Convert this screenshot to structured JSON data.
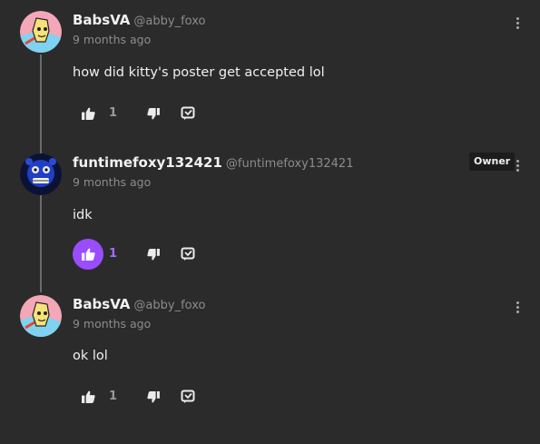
{
  "comments": [
    {
      "username": "BabsVA",
      "handle": "@abby_foxo",
      "timestamp": "9 months ago",
      "text": "how did kitty's poster get accepted lol",
      "like_count": "1",
      "liked": false,
      "avatar": "yellow-cartoon-avatar"
    },
    {
      "username": "funtimefoxy132421",
      "handle": "@funtimefoxy132421",
      "timestamp": "9 months ago",
      "text": "idk",
      "like_count": "1",
      "liked": true,
      "badge": "Owner",
      "avatar": "blue-animatronic-avatar"
    },
    {
      "username": "BabsVA",
      "handle": "@abby_foxo",
      "timestamp": "9 months ago",
      "text": "ok lol",
      "like_count": "1",
      "liked": false,
      "avatar": "yellow-cartoon-avatar"
    }
  ],
  "icons": {
    "like": "thumbs-up-icon",
    "dislike": "thumbs-down-icon",
    "reply": "reply-icon",
    "more": "more-options-icon"
  },
  "colors": {
    "background": "#2b2b2b",
    "accent": "#9a4dff",
    "muted": "#8c8c8c"
  }
}
